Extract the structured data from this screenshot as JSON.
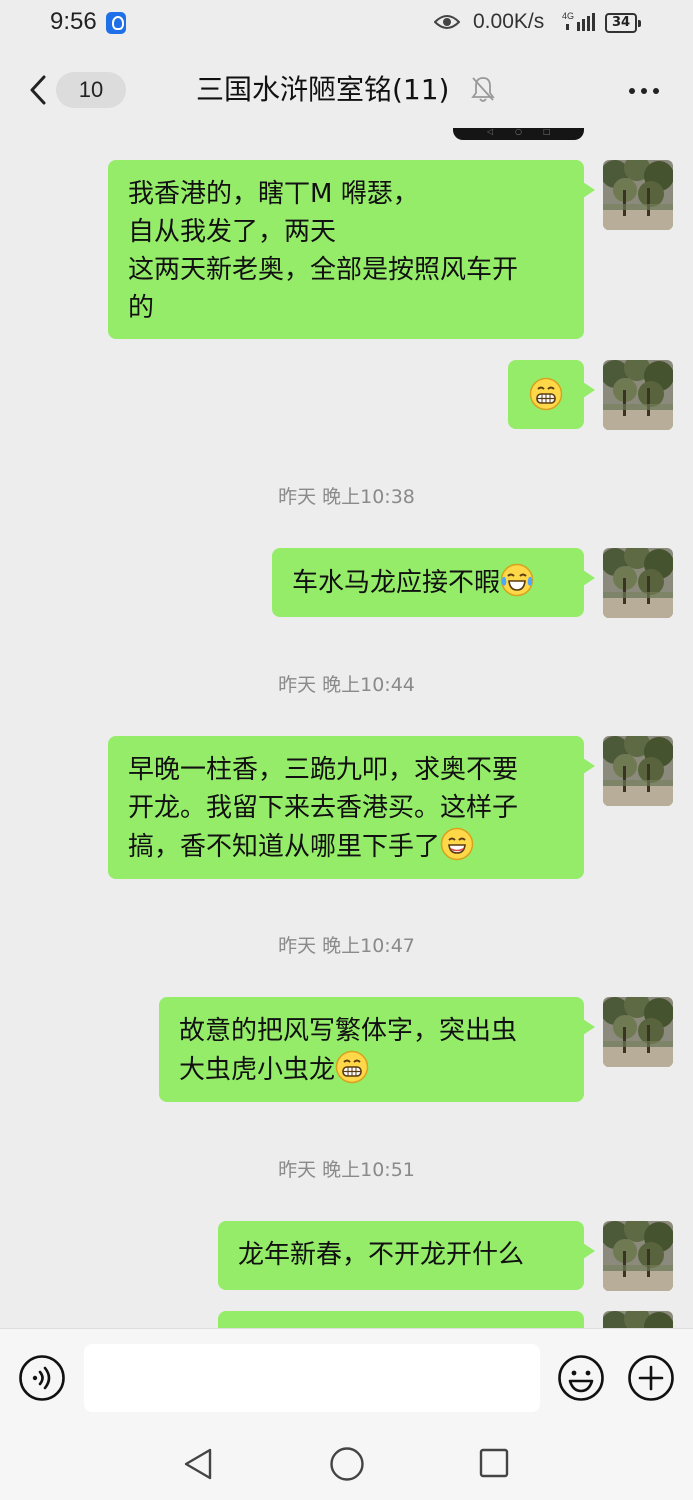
{
  "status_bar": {
    "time": "9:56",
    "net_speed": "0.00K/s",
    "signal_label": "4G",
    "battery": "34"
  },
  "header": {
    "unread_count": "10",
    "title": "三国水浒陋室铭(11)"
  },
  "messages": [
    {
      "type": "sent",
      "lines": [
        "我香港的，瞎丅M 嘚瑟，",
        "自从我发了，两天",
        "这两天新老奥，全部是按照风车开",
        "的"
      ]
    },
    {
      "type": "sent",
      "emoji": "grin-emoji"
    },
    {
      "type": "time",
      "text": "昨天 晚上10:38"
    },
    {
      "type": "sent",
      "lines": [
        "车水马龙应接不暇"
      ],
      "emoji": "tears-of-joy-emoji"
    },
    {
      "type": "time",
      "text": "昨天 晚上10:44"
    },
    {
      "type": "sent",
      "lines": [
        "早晚一柱香，三跪九叩，求奥不要",
        "开龙。我留下来去香港买。这样子",
        "搞，香不知道从哪里下手了"
      ],
      "emoji": "smile-emoji"
    },
    {
      "type": "time",
      "text": "昨天 晚上10:47"
    },
    {
      "type": "sent",
      "lines": [
        "故意的把风写繁体字，突出虫",
        "大虫虎小虫龙"
      ],
      "emoji": "grin-emoji"
    },
    {
      "type": "time",
      "text": "昨天 晚上10:51"
    },
    {
      "type": "sent",
      "lines": [
        "龙年新春，不开龙开什么"
      ]
    }
  ],
  "input": {
    "placeholder": "",
    "value": ""
  },
  "colors": {
    "bubble": "#95ec69",
    "background": "#ededed",
    "timestamp": "#8a8a8a"
  }
}
